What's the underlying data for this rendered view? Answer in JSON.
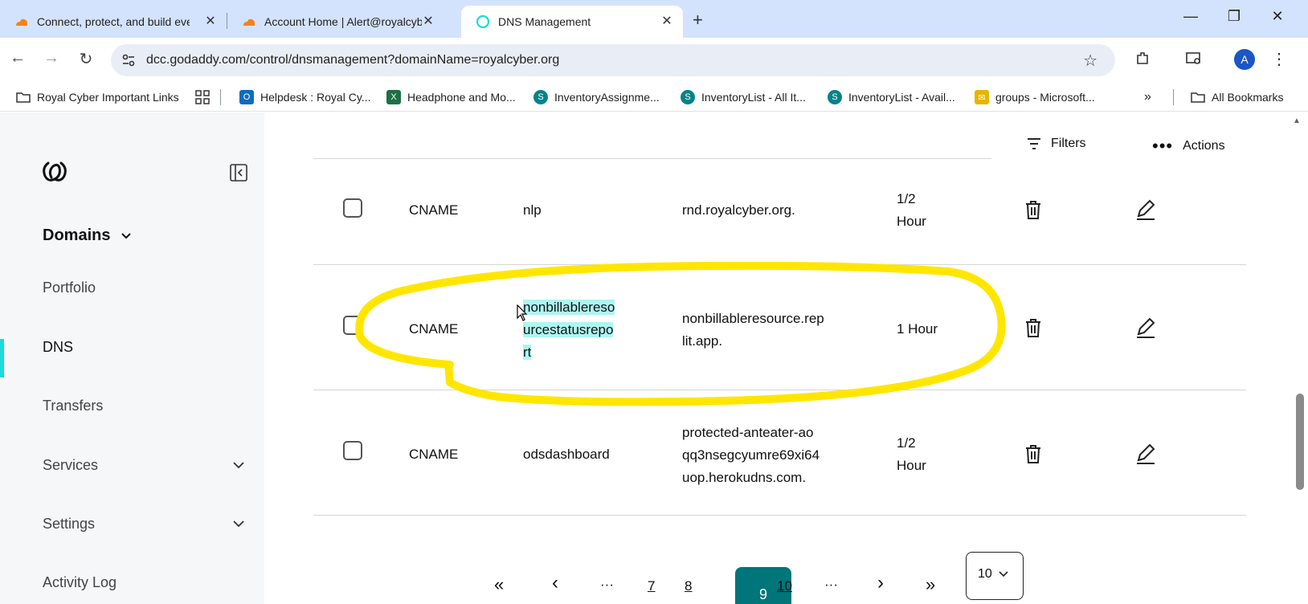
{
  "browser": {
    "tabs": [
      {
        "title": "Connect, protect, and build eve",
        "icon": "cloudflare-icon",
        "active": false
      },
      {
        "title": "Account Home | Alert@royalcyb",
        "icon": "cloudflare-icon",
        "active": false
      },
      {
        "title": "DNS Management",
        "icon": "godaddy-icon",
        "active": true
      }
    ],
    "url": "dcc.godaddy.com/control/dnsmanagement?domainName=royalcyber.org",
    "profile_initial": "A",
    "bookmarks": [
      {
        "label": "Royal Cyber Important Links",
        "icon": "folder-icon"
      },
      {
        "label": "Helpdesk : Royal Cy...",
        "icon": "outlook-icon"
      },
      {
        "label": "Headphone and Mo...",
        "icon": "excel-icon"
      },
      {
        "label": "InventoryAssignme...",
        "icon": "sharepoint-icon"
      },
      {
        "label": "InventoryList - All It...",
        "icon": "sharepoint-icon"
      },
      {
        "label": "InventoryList - Avail...",
        "icon": "sharepoint-icon"
      },
      {
        "label": "groups - Microsoft...",
        "icon": "mail-icon"
      }
    ],
    "all_bookmarks": "All Bookmarks"
  },
  "sidebar": {
    "section": "Domains",
    "items": [
      {
        "label": "Portfolio",
        "active": false
      },
      {
        "label": "DNS",
        "active": true
      },
      {
        "label": "Transfers",
        "active": false
      },
      {
        "label": "Services",
        "active": false,
        "expandable": true
      },
      {
        "label": "Settings",
        "active": false,
        "expandable": true
      },
      {
        "label": "Activity Log",
        "active": false
      }
    ]
  },
  "toolbar": {
    "filters_label": "Filters",
    "actions_label": "Actions"
  },
  "records": [
    {
      "type": "CNAME",
      "name": "nlp",
      "value": "rnd.royalcyber.org.",
      "value_lines": [
        "rnd.royalcyber.org."
      ],
      "ttl_lines": [
        "1/2",
        "Hour"
      ]
    },
    {
      "type": "CNAME",
      "name": "nonbillableresourcestatusreport",
      "name_lines": [
        "nonbillablereso",
        "urcestatusrepo",
        "rt"
      ],
      "value_lines": [
        "nonbillableresource.rep",
        "lit.app."
      ],
      "ttl_lines": [
        "1 Hour"
      ]
    },
    {
      "type": "CNAME",
      "name": "odsdashboard",
      "value_lines": [
        "protected-anteater-ao",
        "qq3nsegcyumre69xi64",
        "uop.herokudns.com."
      ],
      "ttl_lines": [
        "1/2",
        "Hour"
      ]
    }
  ],
  "pagination": {
    "first": "«",
    "prev": "‹",
    "ellipsis_left": "···",
    "page_a": "7",
    "page_b": "8",
    "current": "9",
    "page_c": "10",
    "ellipsis_right": "···",
    "next": "›",
    "last": "»",
    "per_page": "10"
  },
  "colors": {
    "accent_teal": "#00757a",
    "active_indicator": "#1bdbdb",
    "annotation_yellow": "#ffe600",
    "selection_highlight": "#aef5f1"
  }
}
